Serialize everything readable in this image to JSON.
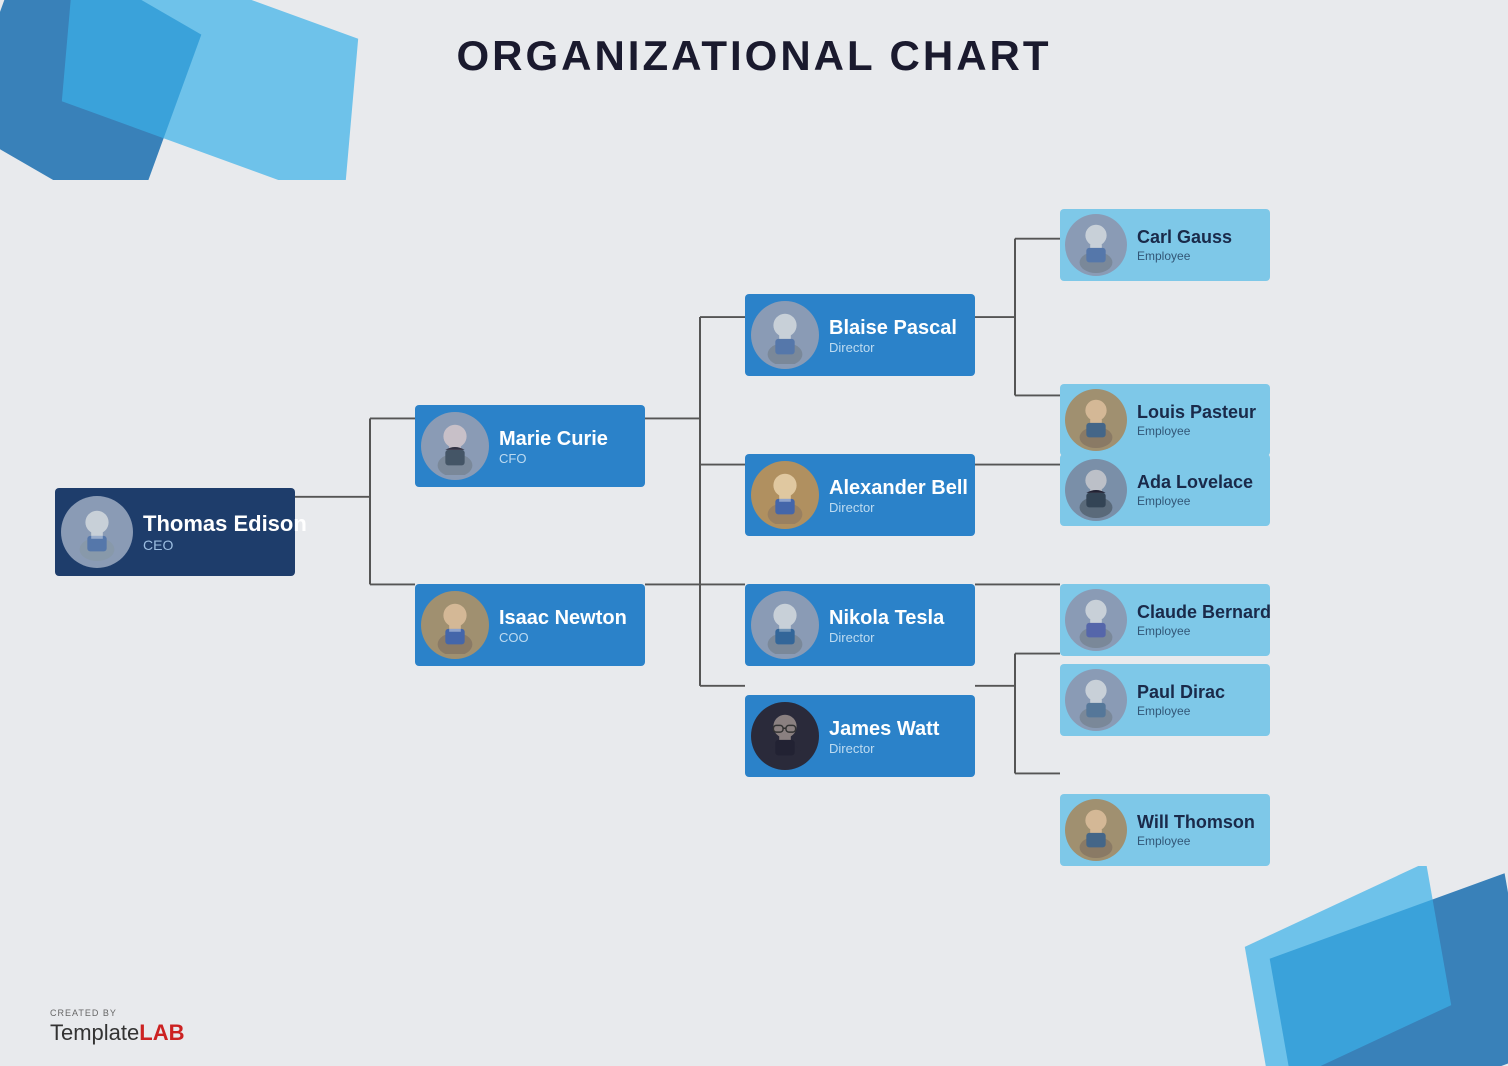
{
  "title": "ORGANIZATIONAL CHART",
  "watermark": {
    "created_by": "CREATED BY",
    "template": "Template",
    "lab": "LAB"
  },
  "nodes": {
    "ceo": {
      "name": "Thomas Edison",
      "title": "CEO",
      "color": "dark",
      "avatar": "male_suit"
    },
    "cfo": {
      "name": "Marie Curie",
      "title": "CFO",
      "color": "blue",
      "avatar": "female_suit"
    },
    "coo": {
      "name": "Isaac Newton",
      "title": "COO",
      "color": "blue",
      "avatar": "male_suit2"
    },
    "directors": [
      {
        "name": "Blaise Pascal",
        "title": "Director",
        "color": "blue",
        "avatar": "male_suit"
      },
      {
        "name": "Alexander Bell",
        "title": "Director",
        "color": "blue",
        "avatar": "male_suit3"
      },
      {
        "name": "Nikola Tesla",
        "title": "Director",
        "color": "blue",
        "avatar": "male_suit"
      },
      {
        "name": "James Watt",
        "title": "Director",
        "color": "blue",
        "avatar": "male_glasses"
      }
    ],
    "employees": [
      {
        "name": "Carl Gauss",
        "title": "Employee",
        "avatar": "male_suit"
      },
      {
        "name": "Louis Pasteur",
        "title": "Employee",
        "avatar": "male_suit2"
      },
      {
        "name": "Ada Lovelace",
        "title": "Employee",
        "avatar": "female_suit"
      },
      {
        "name": "Claude Bernard",
        "title": "Employee",
        "avatar": "male_suit"
      },
      {
        "name": "Paul Dirac",
        "title": "Employee",
        "avatar": "male_suit"
      },
      {
        "name": "Will Thomson",
        "title": "Employee",
        "avatar": "male_suit2"
      }
    ]
  }
}
